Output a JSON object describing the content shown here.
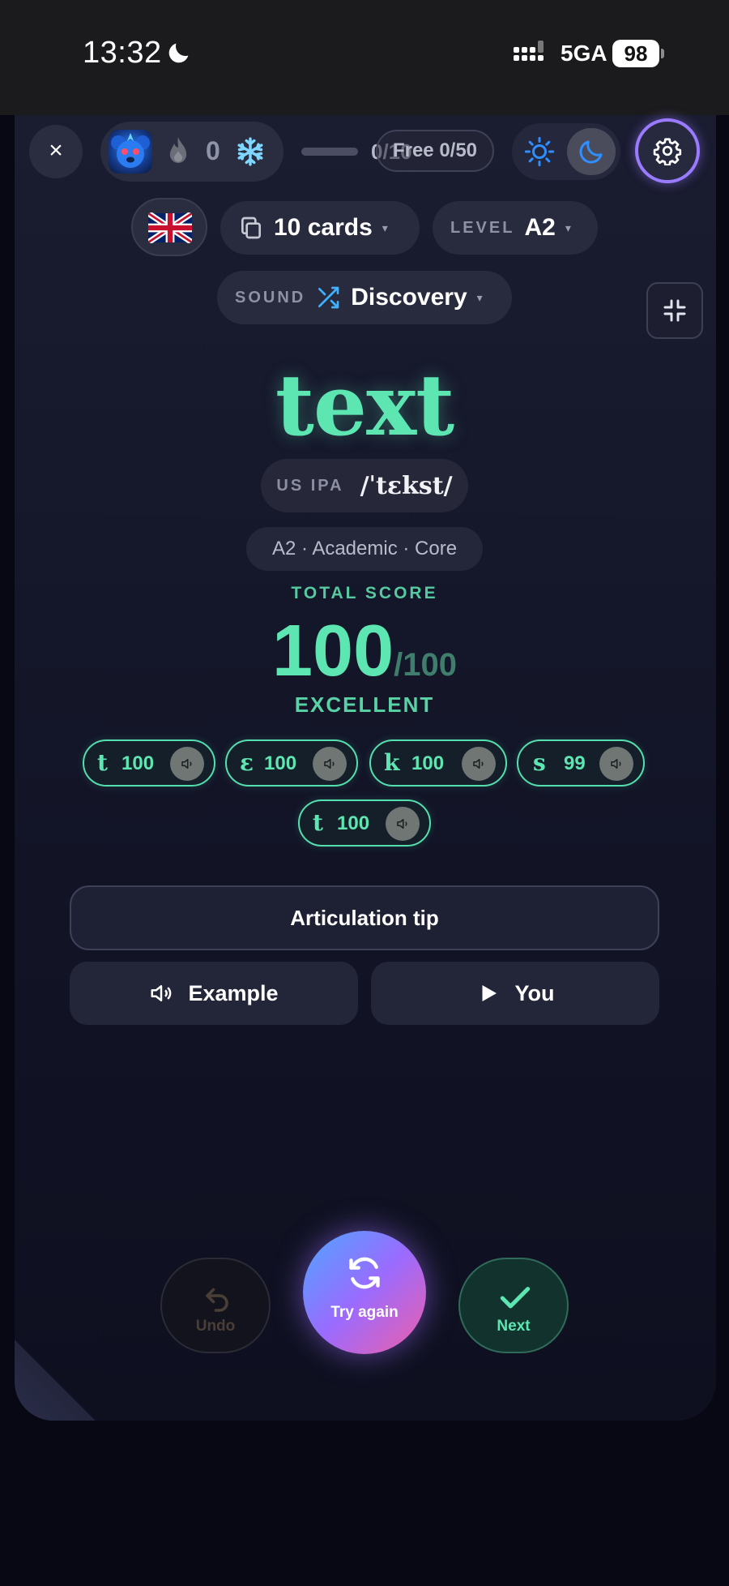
{
  "status_bar": {
    "time": "13:32",
    "network": "5GA",
    "battery": "98"
  },
  "header": {
    "close_label": "×",
    "streak_count": "0",
    "progress_label": "0/10",
    "free_label": "Free 0/50"
  },
  "controls": {
    "cards_label": "10 cards",
    "level_caption": "LEVEL",
    "level_value": "A2",
    "sound_caption": "SOUND",
    "sound_value": "Discovery",
    "caret": "▾"
  },
  "word": {
    "text": "text",
    "ipa_caption": "US IPA",
    "ipa": "/ˈtɛkst/",
    "tags": "A2 · Academic · Core"
  },
  "score": {
    "label": "TOTAL SCORE",
    "value": "100",
    "max": "/100",
    "grade": "EXCELLENT"
  },
  "phonemes": [
    {
      "symbol": "t",
      "score": "100"
    },
    {
      "symbol": "ɛ",
      "score": "100"
    },
    {
      "symbol": "k",
      "score": "100"
    },
    {
      "symbol": "s",
      "score": "99"
    },
    {
      "symbol": "t",
      "score": "100"
    }
  ],
  "actions": {
    "tip_label": "Articulation tip",
    "example_label": "Example",
    "you_label": "You",
    "undo_label": "Undo",
    "retry_label": "Try again",
    "next_label": "Next"
  },
  "colors": {
    "accent": "#5de6b1",
    "settings_ring": "#9a7bff",
    "background": "#070814"
  },
  "icons": [
    "moon-icon",
    "signal-icon",
    "flame-icon",
    "snowflake-icon",
    "sun-icon",
    "gear-icon",
    "uk-flag-icon",
    "copy-icon",
    "shuffle-icon",
    "collapse-icon",
    "speaker-icon",
    "play-icon",
    "undo-icon",
    "refresh-icon",
    "check-icon"
  ]
}
